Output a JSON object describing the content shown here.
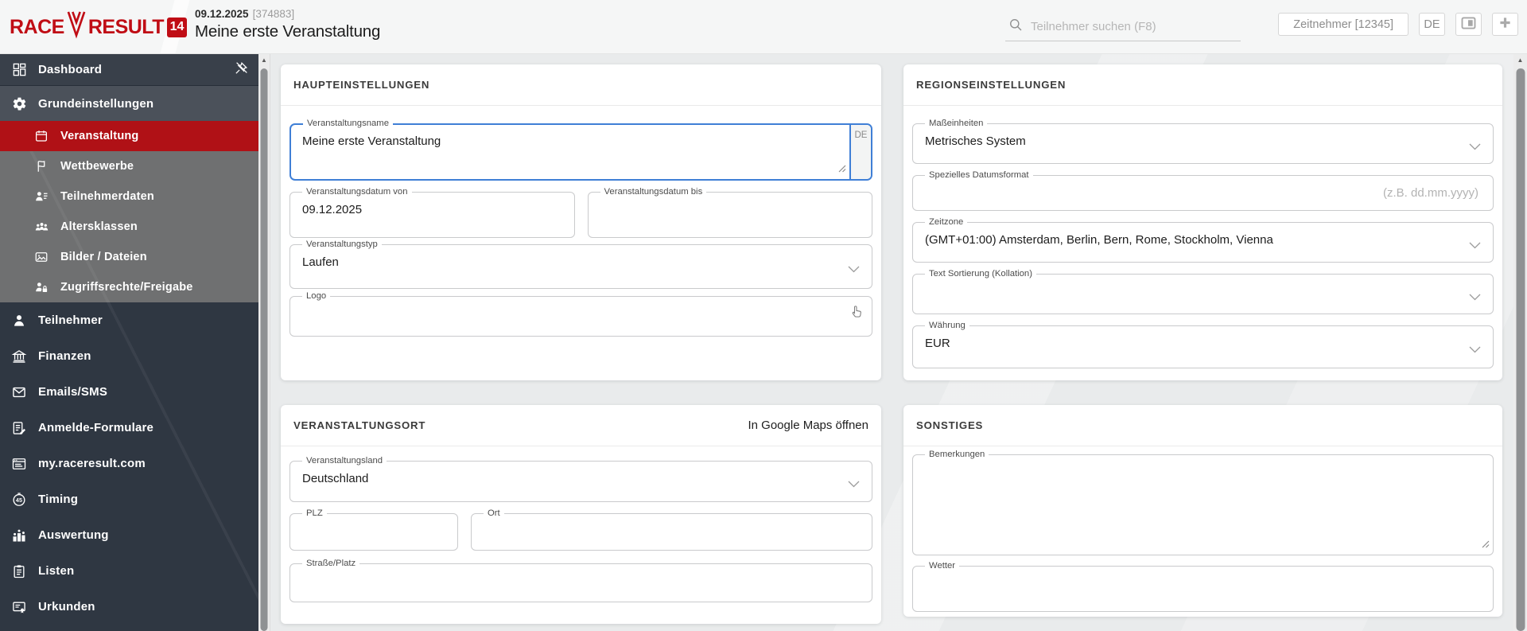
{
  "colors": {
    "brand_red": "#c00d15",
    "selected_red": "#b01116",
    "focus_blue": "#3f7fd6",
    "sidebar_bg": "#2f3742",
    "submenu_gray": "#6f7071",
    "content_bg": "#e9ebec"
  },
  "header": {
    "logo": {
      "race": "RACE",
      "result": "RESULT",
      "version": "14",
      "ribbon_icon": "ribbon-icon"
    },
    "event_date": "09.12.2025",
    "event_id": "[374883]",
    "event_title": "Meine erste Veranstaltung",
    "search": {
      "placeholder": "Teilnehmer suchen (F8)",
      "icon": "search-icon"
    },
    "timer_button": "Zeitnehmer [12345]",
    "language_button": "DE",
    "window_button_icon": "panel-icon",
    "add_button_icon": "plus-icon"
  },
  "sidebar": {
    "items": [
      {
        "label": "Dashboard",
        "icon": "dashboard-icon"
      },
      {
        "label": "Grundeinstellungen",
        "icon": "gear-icon"
      }
    ],
    "sub_items": [
      {
        "label": "Veranstaltung",
        "icon": "calendar-icon",
        "selected": true
      },
      {
        "label": "Wettbewerbe",
        "icon": "flag-icon"
      },
      {
        "label": "Teilnehmerdaten",
        "icon": "person-list-icon"
      },
      {
        "label": "Altersklassen",
        "icon": "people-group-icon"
      },
      {
        "label": "Bilder / Dateien",
        "icon": "image-icon"
      },
      {
        "label": "Zugriffsrechte/Freigabe",
        "icon": "person-lock-icon"
      }
    ],
    "items_lower": [
      {
        "label": "Teilnehmer",
        "icon": "person-icon"
      },
      {
        "label": "Finanzen",
        "icon": "bank-icon"
      },
      {
        "label": "Emails/SMS",
        "icon": "envelope-icon"
      },
      {
        "label": "Anmelde-Formulare",
        "icon": "form-pen-icon"
      },
      {
        "label": "my.raceresult.com",
        "icon": "browser-icon"
      },
      {
        "label": "Timing",
        "icon": "stopwatch-icon"
      },
      {
        "label": "Auswertung",
        "icon": "podium-icon"
      },
      {
        "label": "Listen",
        "icon": "clipboard-icon"
      },
      {
        "label": "Urkunden",
        "icon": "certificate-icon"
      }
    ],
    "unpin_icon": "unpin-icon"
  },
  "cards": {
    "haupteinstellungen": {
      "title": "HAUPTEINSTELLUNGEN",
      "fields": {
        "name": {
          "label": "Veranstaltungsname",
          "value": "Meine erste Veranstaltung",
          "lang_tag": "DE"
        },
        "date_from": {
          "label": "Veranstaltungsdatum von",
          "value": "09.12.2025"
        },
        "date_to": {
          "label": "Veranstaltungsdatum bis",
          "value": ""
        },
        "type": {
          "label": "Veranstaltungstyp",
          "value": "Laufen"
        },
        "logo": {
          "label": "Logo",
          "value": "",
          "icon": "hand-pointer-icon"
        }
      }
    },
    "veranstaltungsort": {
      "title": "VERANSTALTUNGSORT",
      "maps_link": "In Google Maps öffnen",
      "fields": {
        "country": {
          "label": "Veranstaltungsland",
          "value": "Deutschland"
        },
        "plz": {
          "label": "PLZ",
          "value": ""
        },
        "ort": {
          "label": "Ort",
          "value": ""
        },
        "strasse": {
          "label": "Straße/Platz",
          "value": ""
        }
      }
    },
    "regionseinstellungen": {
      "title": "REGIONSEINSTELLUNGEN",
      "fields": {
        "units": {
          "label": "Maßeinheiten",
          "value": "Metrisches System"
        },
        "date_format": {
          "label": "Spezielles Datumsformat",
          "value": "",
          "placeholder": "(z.B. dd.mm.yyyy)"
        },
        "timezone": {
          "label": "Zeitzone",
          "value": "(GMT+01:00) Amsterdam, Berlin, Bern, Rome, Stockholm, Vienna"
        },
        "collation": {
          "label": "Text Sortierung (Kollation)",
          "value": ""
        },
        "currency": {
          "label": "Währung",
          "value": "EUR"
        }
      }
    },
    "sonstiges": {
      "title": "SONSTIGES",
      "fields": {
        "remarks": {
          "label": "Bemerkungen",
          "value": ""
        },
        "weather": {
          "label": "Wetter",
          "value": ""
        }
      }
    }
  }
}
